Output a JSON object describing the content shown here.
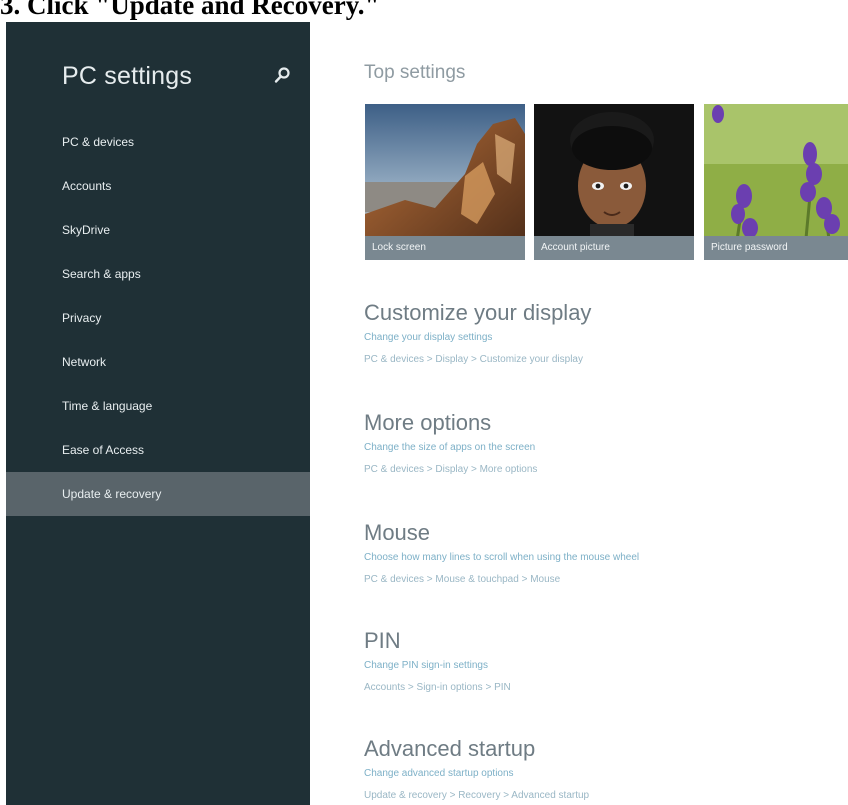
{
  "caption": "3. Click \"Update and Recovery.\"",
  "sidebar": {
    "title": "PC settings",
    "items": [
      {
        "label": "PC & devices",
        "selected": false
      },
      {
        "label": "Accounts",
        "selected": false
      },
      {
        "label": "SkyDrive",
        "selected": false
      },
      {
        "label": "Search & apps",
        "selected": false
      },
      {
        "label": "Privacy",
        "selected": false
      },
      {
        "label": "Network",
        "selected": false
      },
      {
        "label": "Time & language",
        "selected": false
      },
      {
        "label": "Ease of Access",
        "selected": false
      },
      {
        "label": "Update & recovery",
        "selected": true
      }
    ]
  },
  "main": {
    "top_title": "Top settings",
    "tiles": [
      {
        "label": "Lock screen"
      },
      {
        "label": "Account picture"
      },
      {
        "label": "Picture password"
      }
    ],
    "sections": [
      {
        "title": "Customize your display",
        "link": "Change your display settings",
        "path": "PC & devices > Display > Customize your display"
      },
      {
        "title": "More options",
        "link": "Change the size of apps on the screen",
        "path": "PC & devices > Display > More options"
      },
      {
        "title": "Mouse",
        "link": "Choose how many lines to scroll when using the mouse wheel",
        "path": "PC & devices > Mouse & touchpad > Mouse"
      },
      {
        "title": "PIN",
        "link": "Change PIN sign-in settings",
        "path": "Accounts > Sign-in options > PIN"
      },
      {
        "title": "Advanced startup",
        "link": "Change advanced startup options",
        "path": "Update & recovery > Recovery > Advanced startup"
      }
    ]
  },
  "colors": {
    "sidebar_bg": "#1f3036",
    "selected_bg": "#59646a",
    "link": "#7db0c7",
    "heading": "#6f7c84"
  },
  "icons": {
    "search": "search-icon"
  }
}
